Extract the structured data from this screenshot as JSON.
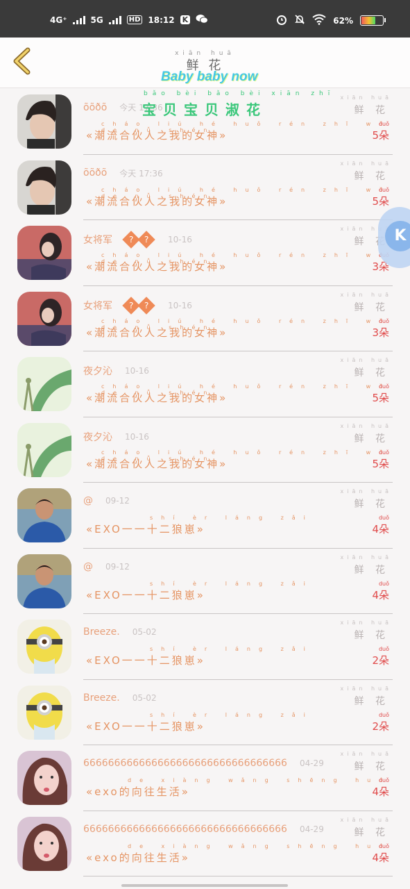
{
  "status": {
    "net1": "4G⁺",
    "net2": "5G",
    "hd": "HD",
    "time": "18:12",
    "app_badge": "K",
    "battery": "62%"
  },
  "nav": {
    "title": "鲜 花",
    "title_pinyin": "xiān huā",
    "subtitle": "Baby baby now",
    "overlay_text": "宝贝宝贝淑花",
    "overlay_pinyin": "bǎo bèi bǎo bèi xiān zhī"
  },
  "labels": {
    "flower": "鲜 花",
    "flower_pinyin": "xiān huā",
    "count_pinyin": "duǒ"
  },
  "rows": [
    {
      "name": "õõðõ",
      "date": "今天 17:36",
      "song": "«潮流合伙人之我的女神»",
      "song_pinyin": "cháo liú hé huǒ rén zhī wǒ de nǚ shén",
      "count": "5朵",
      "avatar": "boy-dark-hair"
    },
    {
      "name": "õõðõ",
      "date": "今天 17:36",
      "song": "«潮流合伙人之我的女神»",
      "song_pinyin": "cháo liú hé huǒ rén zhī wǒ de nǚ shén",
      "count": "5朵",
      "avatar": "boy-dark-hair"
    },
    {
      "name": "女将军",
      "date": "10-16",
      "song": "«潮流合伙人之我的女神»",
      "song_pinyin": "cháo liú hé huǒ rén zhī wǒ de nǚ shén",
      "count": "3朵",
      "avatar": "girl-red-scene",
      "badges": [
        "?",
        "?"
      ]
    },
    {
      "name": "女将军",
      "date": "10-16",
      "song": "«潮流合伙人之我的女神»",
      "song_pinyin": "cháo liú hé huǒ rén zhī wǒ de nǚ shén",
      "count": "3朵",
      "avatar": "girl-red-scene",
      "badges": [
        "?",
        "?"
      ]
    },
    {
      "name": "夜夕沁",
      "date": "10-16",
      "song": "«潮流合伙人之我的女神»",
      "song_pinyin": "cháo liú hé huǒ rén zhī wǒ de nǚ shén",
      "count": "5朵",
      "avatar": "green-leaf"
    },
    {
      "name": "夜夕沁",
      "date": "10-16",
      "song": "«潮流合伙人之我的女神»",
      "song_pinyin": "cháo liú hé huǒ rén zhī wǒ de nǚ shén",
      "count": "5朵",
      "avatar": "green-leaf"
    },
    {
      "name": "@",
      "date": "09-12",
      "song": "«EXO一一十二狼崽»",
      "song_pinyin": "shí èr láng zǎi",
      "count": "4朵",
      "avatar": "man-blue-shirt"
    },
    {
      "name": "@",
      "date": "09-12",
      "song": "«EXO一一十二狼崽»",
      "song_pinyin": "shí èr láng zǎi",
      "count": "4朵",
      "avatar": "man-blue-shirt"
    },
    {
      "name": "Breeze.",
      "date": "05-02",
      "song": "«EXO一一十二狼崽»",
      "song_pinyin": "shí èr láng zǎi",
      "count": "2朵",
      "avatar": "minion"
    },
    {
      "name": "Breeze.",
      "date": "05-02",
      "song": "«EXO一一十二狼崽»",
      "song_pinyin": "shí èr láng zǎi",
      "count": "2朵",
      "avatar": "minion"
    },
    {
      "name": "666666666666666666666666666666666",
      "date": "04-29",
      "song": "«exo的向往生活»",
      "song_pinyin": "de xiàng wǎng shēng huó",
      "count": "4朵",
      "avatar": "girl-pink"
    },
    {
      "name": "666666666666666666666666666666666",
      "date": "04-29",
      "song": "«exo的向往生活»",
      "song_pinyin": "de xiàng wǎng shēng huó",
      "count": "4朵",
      "avatar": "girl-pink"
    }
  ],
  "colors": {
    "accent_orange": "#e59463",
    "count_red": "#e04a4a",
    "title_cyan": "#44c7e5",
    "overlay_green": "#3ac77a"
  }
}
